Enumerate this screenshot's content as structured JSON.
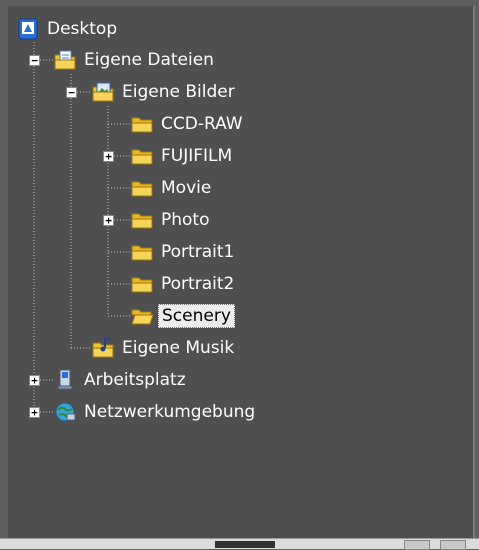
{
  "tree": {
    "desktop": "Desktop",
    "my_documents": "Eigene Dateien",
    "my_pictures": "Eigene Bilder",
    "folders": [
      "CCD-RAW",
      "FUJIFILM",
      "Movie",
      "Photo",
      "Portrait1",
      "Portrait2",
      "Scenery"
    ],
    "my_music": "Eigene Musik",
    "my_computer": "Arbeitsplatz",
    "network": "Netzwerkumgebung",
    "selected": "Scenery"
  },
  "colors": {
    "background": "#4f4f4f",
    "folder": "#f0c430",
    "selection": "#ececec"
  }
}
